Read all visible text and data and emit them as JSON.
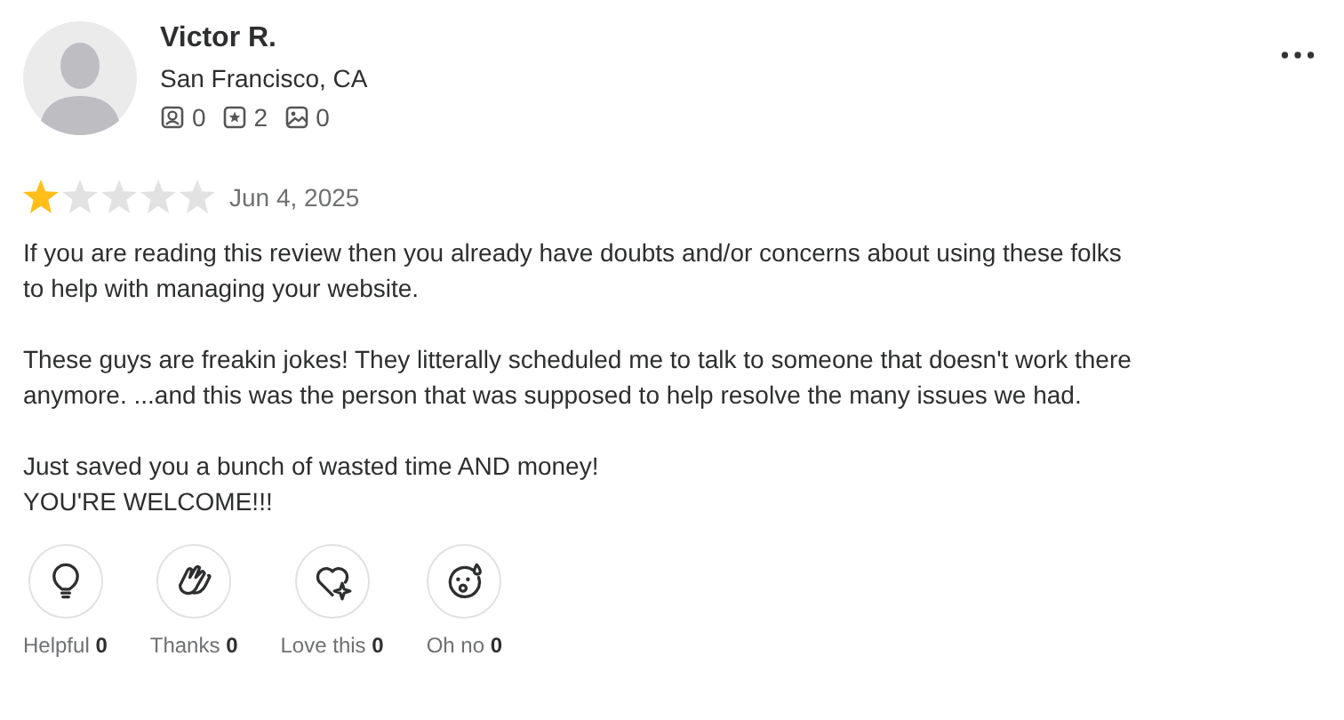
{
  "user": {
    "name": "Victor R.",
    "location": "San Francisco, CA",
    "stats": [
      {
        "kind": "friends",
        "count": "0"
      },
      {
        "kind": "reviews",
        "count": "2"
      },
      {
        "kind": "photos",
        "count": "0"
      }
    ]
  },
  "review": {
    "stars": 1,
    "date": "Jun 4, 2025",
    "paragraphs": [
      [
        "If you are reading this review then you already have doubts and/or concerns about using these folks to help with managing your website."
      ],
      [
        "These guys are freakin jokes! They litterally scheduled me to talk to someone that doesn't work there anymore. ...and this was the person that was supposed to help resolve the many issues we had."
      ],
      [
        "Just saved you a bunch of wasted time AND money!",
        "YOU'RE WELCOME!!!"
      ]
    ]
  },
  "reactions": [
    {
      "kind": "helpful",
      "label": "Helpful **0**"
    },
    {
      "kind": "thanks",
      "label": "Thanks **0**"
    },
    {
      "kind": "love",
      "label": "Love this **0**"
    },
    {
      "kind": "ohno",
      "label": "Oh no **0**"
    }
  ]
}
